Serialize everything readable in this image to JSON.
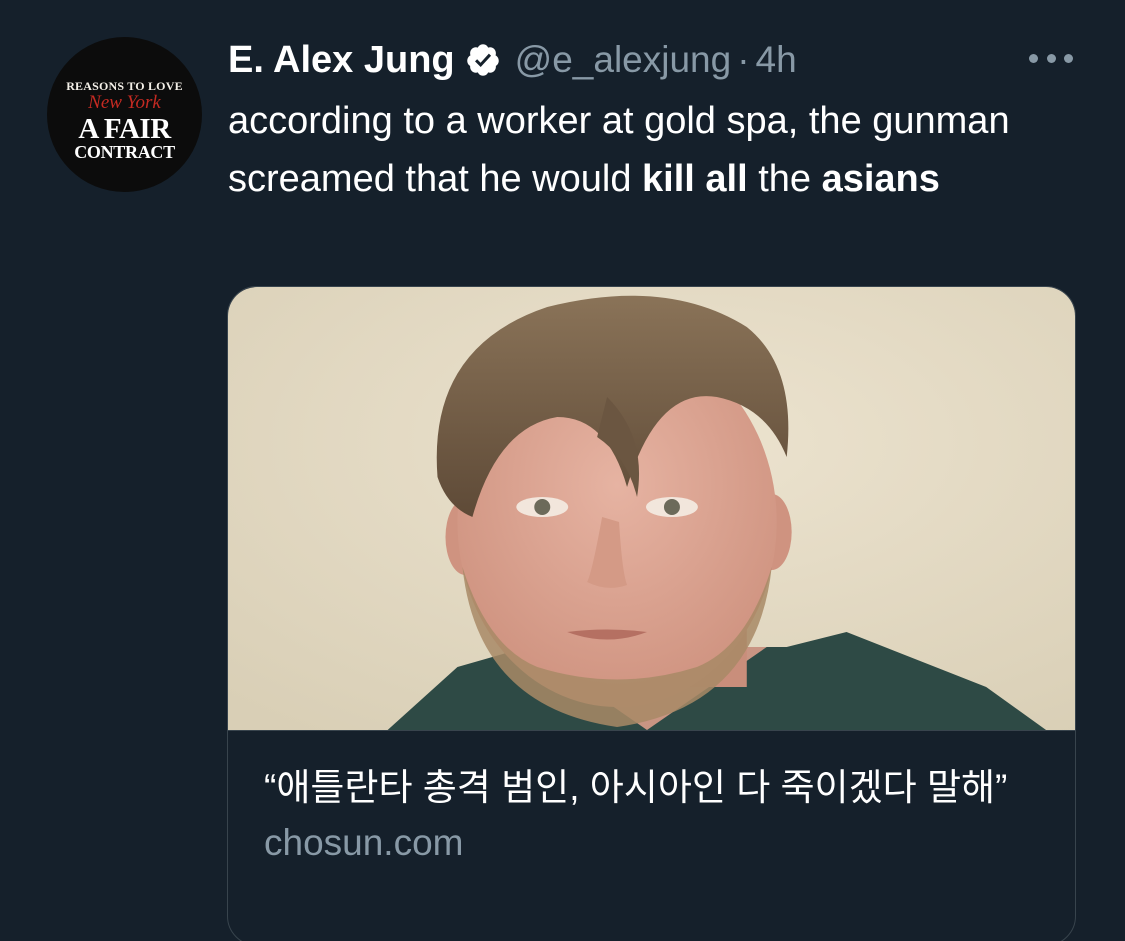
{
  "tweet": {
    "avatar": {
      "line1": "REASONS TO LOVE",
      "line2": "New York",
      "line3": "A FAIR",
      "line4": "CONTRACT"
    },
    "author_name": "E. Alex Jung",
    "handle": "@e_alexjung",
    "separator": "·",
    "timestamp": "4h",
    "text_part1": "according to a worker at gold spa, the gunman screamed that he would ",
    "text_bold1": "kill all",
    "text_part2": " the ",
    "text_bold2": "asians",
    "card": {
      "title": "“애틀란타 총격 범인, 아시아인 다 죽이겠다 말해”",
      "domain": "chosun.com"
    }
  },
  "icons": {
    "verified": "verified-badge-icon",
    "more": "more-options-icon"
  },
  "colors": {
    "background": "#15202b",
    "secondary_text": "#8899a6",
    "border": "#38444d"
  }
}
